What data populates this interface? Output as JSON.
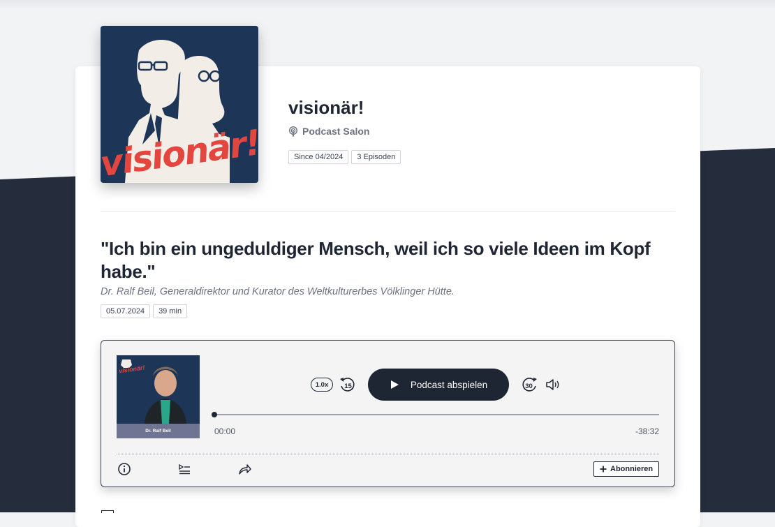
{
  "podcast": {
    "title": "visionär!",
    "author": "Podcast Salon",
    "since": "Since 04/2024",
    "episodes": "3 Episoden",
    "cover_word": "visionär!",
    "brand_color": "#e2463e",
    "cover_bg": "#1d3557"
  },
  "episode": {
    "title": "\"Ich bin ein ungeduldiger Mensch, weil ich so viele Ideen im Kopf habe.\"",
    "subtitle": "Dr. Ralf Beil, Generaldirektor und Kurator des Weltkulturerbes Völklinger Hütte.",
    "date": "05.07.2024",
    "duration": "39 min"
  },
  "player": {
    "cover_name": "Dr. Ralf Beil",
    "cover_word": "visionär!",
    "speed": "1.0x",
    "skip_back": "15",
    "play_label": "Podcast abspielen",
    "skip_forward": "30",
    "elapsed": "00:00",
    "remaining": "-38:32",
    "progress": 0,
    "subscribe_label": "Abonnieren",
    "icons": [
      "info-icon",
      "playlist-icon",
      "share-icon",
      "volume-icon",
      "play-icon",
      "plus-icon",
      "podcast-icon"
    ]
  }
}
